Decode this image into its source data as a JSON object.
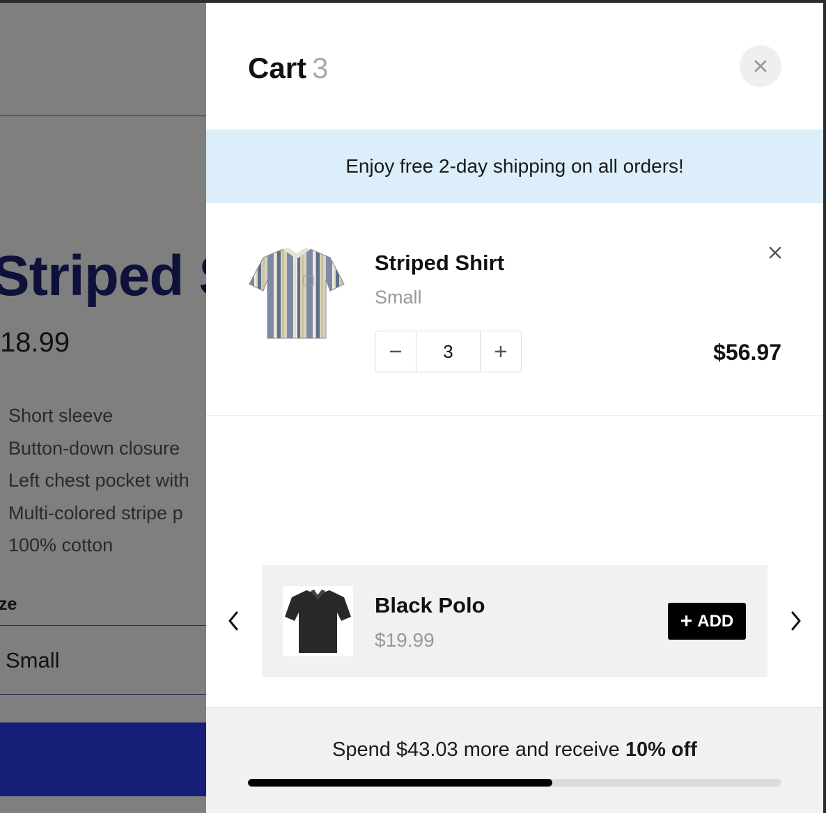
{
  "product_page": {
    "title": "Striped S",
    "price": "18.99",
    "features": [
      "Short sleeve",
      "Button-down closure",
      "Left chest pocket with",
      "Multi-colored stripe p",
      "100% cotton"
    ],
    "size_label": "ze",
    "size_value": "Small",
    "primary_color": "#2c3cf0"
  },
  "cart": {
    "title": "Cart",
    "count": "3",
    "banner": "Enjoy free 2-day shipping on all orders!",
    "item": {
      "name": "Striped Shirt",
      "variant": "Small",
      "quantity": "3",
      "line_price": "$56.97"
    },
    "upsell": {
      "name": "Black Polo",
      "price": "$19.99",
      "add_label": "ADD",
      "add_icon": "+"
    },
    "footer": {
      "message_prefix": "Spend $43.03 more and receive ",
      "message_bold": "10% off",
      "progress_fraction": 0.57
    },
    "icons": {
      "close": "close-icon",
      "remove": "remove-item-icon",
      "minus": "minus-icon",
      "plus": "plus-icon",
      "prev": "chevron-left-icon",
      "next": "chevron-right-icon"
    },
    "colors": {
      "banner_bg": "#dbeefa",
      "accent": "#000000",
      "muted_text": "#999999"
    }
  }
}
